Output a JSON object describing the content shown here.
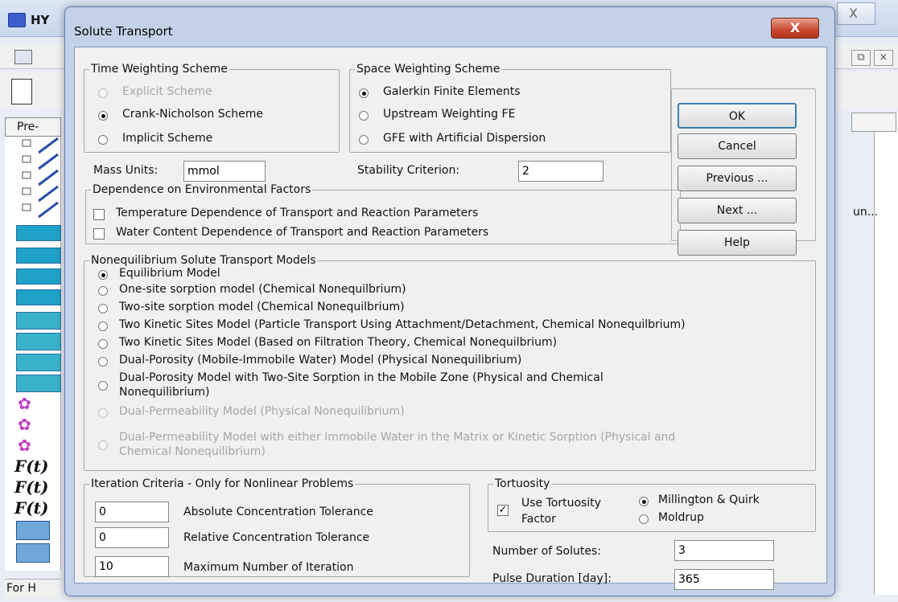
{
  "app": {
    "title": "HY",
    "status_left": "For H",
    "right_snippet": "un...",
    "mdi_icons": [
      "minimize-icon",
      "restore-icon",
      "close-icon"
    ],
    "close_glyph": "×",
    "restore_glyph": "⧉",
    "bg_close_glyph": "X",
    "pre_label": "Pre-"
  },
  "dialog": {
    "title": "Solute Transport",
    "close_glyph": "X",
    "time_weighting": {
      "legend": "Time Weighting Scheme",
      "options": [
        "Explicit Scheme",
        "Crank-Nicholson Scheme",
        "Implicit Scheme"
      ],
      "selected": "Crank-Nicholson Scheme"
    },
    "space_weighting": {
      "legend": "Space Weighting Scheme",
      "options": [
        "Galerkin Finite Elements",
        "Upstream Weighting FE",
        "GFE with Artificial Dispersion"
      ],
      "selected": "Galerkin Finite Elements"
    },
    "mass_units": {
      "label": "Mass Units:",
      "value": "mmol"
    },
    "stability": {
      "label": "Stability Criterion:",
      "value": "2"
    },
    "environment": {
      "legend": "Dependence on Environmental Factors",
      "options": [
        "Temperature Dependence of Transport and Reaction Parameters",
        "Water Content Dependence of Transport and Reaction Parameters"
      ]
    },
    "buttons": {
      "ok": "OK",
      "cancel": "Cancel",
      "previous": "Previous ...",
      "next": "Next ...",
      "help": "Help"
    },
    "noneq": {
      "legend": "Nonequilibrium Solute Transport Models",
      "options": [
        "Equilibrium Model",
        "One-site sorption model (Chemical Nonequilbrium)",
        "Two-site sorption model (Chemical Nonequilbrium)",
        "Two Kinetic Sites Model (Particle Transport Using Attachment/Detachment, Chemical Nonequilbrium)",
        "Two Kinetic Sites Model (Based on Filtration Theory, Chemical Nonequilbrium)",
        "Dual-Porosity (Mobile-Immobile Water) Model (Physical Nonequilibrium)",
        "Dual-Porosity Model with Two-Site Sorption in the Mobile Zone (Physical and Chemical",
        "Nonequilibrium)",
        "Dual-Permeability Model (Physical Nonequilibrium)",
        "Dual-Permeability Model with either Immobile Water in the Matrix or Kinetic Sorption (Physical and",
        "Chemical Nonequilibrium)"
      ],
      "selected": "Equilibrium Model"
    },
    "iteration": {
      "legend": "Iteration Criteria - Only for Nonlinear Problems",
      "rows": [
        {
          "value": "0",
          "label": "Absolute Concentration Tolerance"
        },
        {
          "value": "0",
          "label": "Relative Concentration Tolerance"
        },
        {
          "value": "10",
          "label": "Maximum Number of Iteration"
        }
      ]
    },
    "tortuosity": {
      "legend": "Tortuosity",
      "use_line1": "Use Tortuosity",
      "use_line2": "Factor",
      "use_checked": "✓",
      "options": [
        "Millington & Quirk",
        "Moldrup"
      ],
      "selected": "Millington & Quirk"
    },
    "num_solutes": {
      "label": "Number of Solutes:",
      "value": "3"
    },
    "pulse": {
      "label": "Pulse Duration [day]:",
      "value": "365"
    }
  }
}
